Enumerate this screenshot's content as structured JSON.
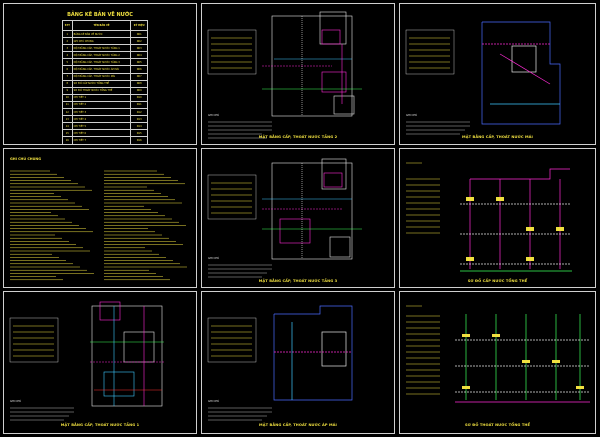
{
  "index": {
    "title": "BẢNG KÊ BẢN VẼ NƯỚC",
    "headers": [
      "STT",
      "TÊN BẢN VẼ",
      "KÝ HIỆU"
    ],
    "rows": [
      [
        "1",
        "BẢNG KÊ BẢN VẼ NƯỚC",
        "N01"
      ],
      [
        "2",
        "GHI CHÚ CHUNG",
        "N02"
      ],
      [
        "3",
        "MẶT BẰNG CẤP, THOÁT NƯỚC TẦNG 1",
        "N03"
      ],
      [
        "4",
        "MẶT BẰNG CẤP, THOÁT NƯỚC TẦNG 2",
        "N04"
      ],
      [
        "5",
        "MẶT BẰNG CẤP, THOÁT NƯỚC TẦNG 3",
        "N05"
      ],
      [
        "6",
        "MẶT BẰNG CẤP, THOÁT NƯỚC ÁP MÁI",
        "N06"
      ],
      [
        "7",
        "MẶT BẰNG CẤP, THOÁT NƯỚC MÁI",
        "N07"
      ],
      [
        "8",
        "SƠ ĐỒ CẤP NƯỚC TỔNG THỂ",
        "N08"
      ],
      [
        "9",
        "SƠ ĐỒ THOÁT NƯỚC TỔNG THỂ",
        "N09"
      ],
      [
        "10",
        "CHI TIẾT 1",
        "N10"
      ],
      [
        "11",
        "CHI TIẾT 2",
        "N11"
      ],
      [
        "12",
        "CHI TIẾT 3",
        "N12"
      ],
      [
        "13",
        "CHI TIẾT 4",
        "N13"
      ],
      [
        "14",
        "CHI TIẾT 5",
        "N14"
      ],
      [
        "15",
        "CHI TIẾT 6",
        "N15"
      ],
      [
        "16",
        "CHI TIẾT 7",
        "N16"
      ],
      [
        "17",
        "CHI TIẾT 8",
        "N17"
      ]
    ]
  },
  "notes": {
    "title": "GHI CHÚ CHUNG"
  },
  "captions": {
    "floor2": "MẶT BẰNG CẤP, THOÁT NƯỚC TẦNG 2",
    "roof": "MẶT BẰNG CẤP, THOÁT NƯỚC MÁI",
    "floor3": "MẶT BẰNG CẤP, THOÁT NƯỚC TẦNG 3",
    "supply": "SƠ ĐỒ CẤP NƯỚC TỔNG THỂ",
    "floor1": "MẶT BẰNG CẤP, THOÁT NƯỚC TẦNG 1",
    "attic": "MẶT BẰNG CẤP, THOÁT NƯỚC ÁP MÁI",
    "drain": "SƠ ĐỒ THOÁT NƯỚC TỔNG THỂ"
  },
  "legend_label": "GHI CHÚ",
  "colors": {
    "yellow": "#f0e040",
    "magenta": "#ff2bd6",
    "cyan": "#3ec8ff",
    "green": "#3cff5a",
    "blue": "#4a6bff",
    "white": "#e8e8e8",
    "red": "#ff3030"
  }
}
